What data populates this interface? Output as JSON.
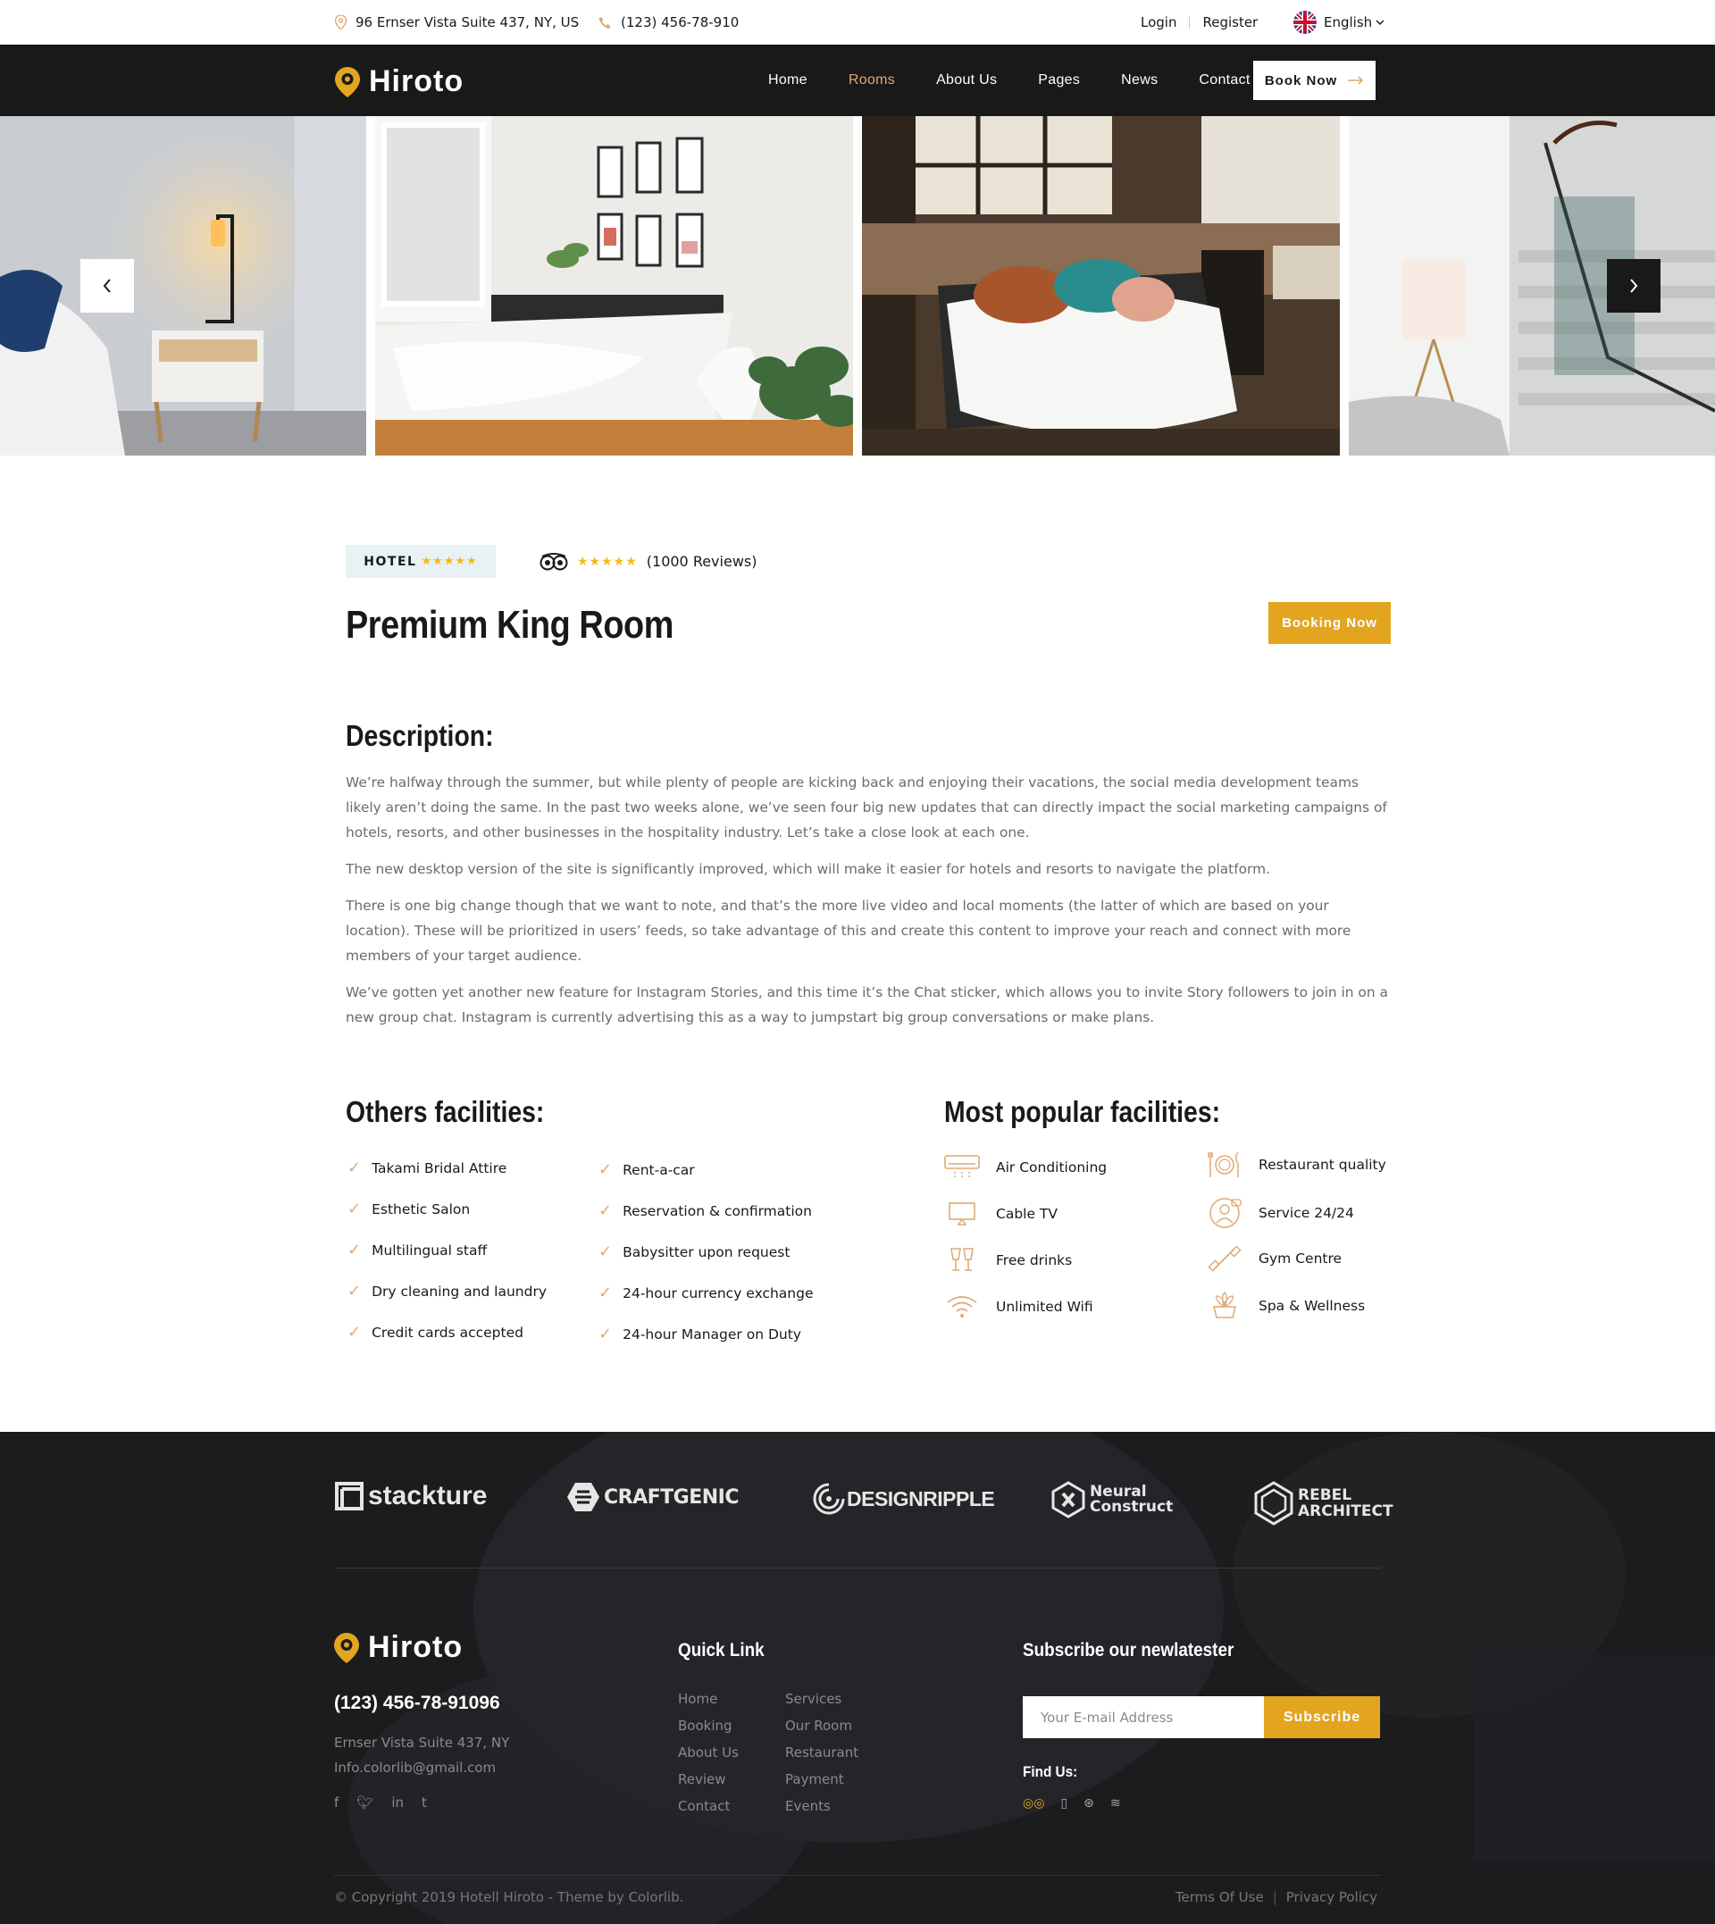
{
  "topbar": {
    "address": "96 Ernser Vista Suite 437, NY, US",
    "phone": "(123) 456-78-910",
    "login": "Login",
    "register": "Register",
    "language": "English"
  },
  "nav": {
    "brand": "Hiroto",
    "links": [
      "Home",
      "Rooms",
      "About Us",
      "Pages",
      "News",
      "Contact"
    ],
    "active": "Rooms",
    "book_now": "Book Now"
  },
  "room": {
    "badge": "HOTEL",
    "badge_stars": "★★★★★",
    "review_stars": "★★★★★",
    "reviews": "(1000 Reviews)",
    "title": "Premium King Room",
    "booking_now": "Booking Now"
  },
  "description": {
    "heading": "Description:",
    "paragraphs": [
      "We’re halfway through the summer, but while plenty of people are kicking back and enjoying their vacations, the social media development teams likely aren’t doing the same. In the past two weeks alone, we’ve seen four big new updates that can directly impact the social marketing campaigns of hotels, resorts, and other businesses in the hospitality industry. Let’s take a close look at each one.",
      "The new desktop version of the site is significantly improved, which will make it easier for hotels and resorts to navigate the platform.",
      "There is one big change though that we want to note, and that’s the more live video and local moments (the latter of which are based on your location). These will be prioritized in users’ feeds, so take advantage of this and create this content to improve your reach and connect with more members of your target audience.",
      "We’ve gotten yet another new feature for Instagram Stories, and this time it’s the Chat sticker, which allows you to invite Story followers to join in on a new group chat. Instagram is currently advertising this as a way to jumpstart big group conversations or make plans."
    ]
  },
  "others": {
    "heading": "Others facilities:",
    "col1": [
      "Takami Bridal Attire",
      "Esthetic Salon",
      "Multilingual staff",
      "Dry cleaning and laundry",
      "Credit cards accepted"
    ],
    "col2": [
      "Rent-a-car",
      "Reservation & confirmation",
      "Babysitter upon request",
      "24-hour currency exchange",
      "24-hour Manager on Duty"
    ]
  },
  "popular": {
    "heading": "Most popular facilities:",
    "col1": [
      "Air Conditioning",
      "Cable TV",
      "Free drinks",
      "Unlimited Wifi"
    ],
    "col2": [
      "Restaurant quality",
      "Service 24/24",
      "Gym Centre",
      "Spa & Wellness"
    ],
    "icons1": [
      "air-conditioner-icon",
      "tv-icon",
      "drinks-icon",
      "wifi-icon"
    ],
    "icons2": [
      "restaurant-icon",
      "service-icon",
      "gym-icon",
      "spa-icon"
    ]
  },
  "footer": {
    "partners": [
      "stackture",
      "CRAFTGENIC",
      "DESIGNRIPPLE",
      "Neural Construct",
      "REBEL ARCHITECT"
    ],
    "brand": "Hiroto",
    "phone": "(123) 456-78-91096",
    "address": "Ernser Vista Suite 437, NY",
    "email": "Info.colorlib@gmail.com",
    "quick_link_heading": "Quick Link",
    "quick_links_1": [
      "Home",
      "Booking",
      "About Us",
      "Review",
      "Contact"
    ],
    "quick_links_2": [
      "Services",
      "Our Room",
      "Restaurant",
      "Payment",
      "Events"
    ],
    "subscribe_heading": "Subscribe our newlatester",
    "email_placeholder": "Your E-mail Address",
    "subscribe": "Subscribe",
    "find_us": "Find Us:",
    "copyright": "© Copyright 2019 Hotell Hiroto - Theme by Colorlib.",
    "terms": "Terms Of Use",
    "privacy": "Privacy Policy"
  },
  "colors": {
    "accent": "#dfa974",
    "button": "#e3a520",
    "dark": "#19191a"
  }
}
